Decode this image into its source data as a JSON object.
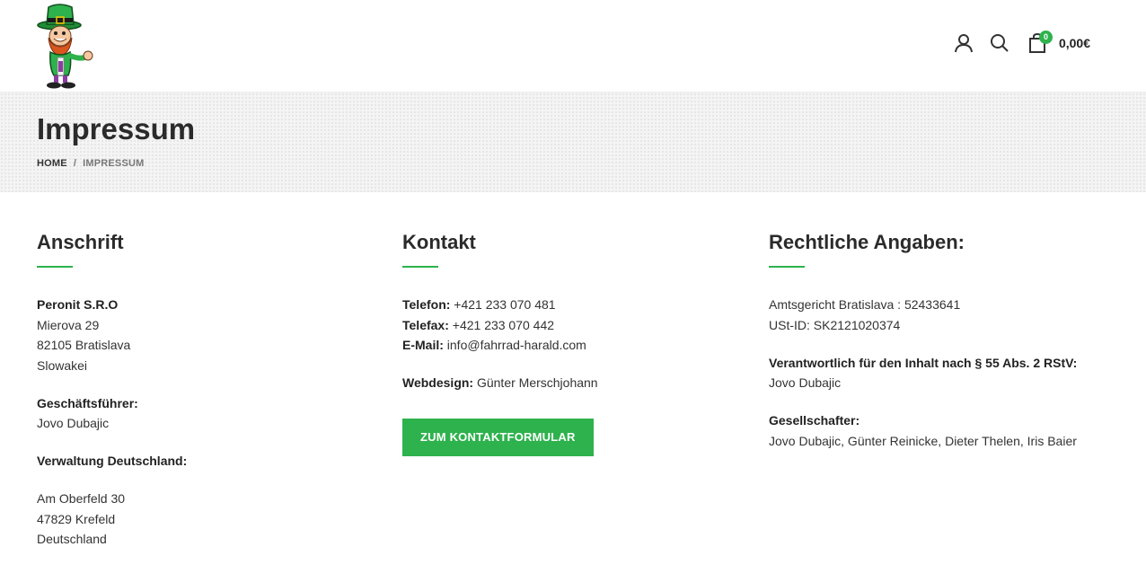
{
  "header": {
    "cart": {
      "count": "0",
      "total": "0,00€"
    }
  },
  "title_band": {
    "title": "Impressum",
    "breadcrumb": {
      "home": "HOME",
      "separator": "/",
      "current": "IMPRESSUM"
    }
  },
  "anschrift": {
    "heading": "Anschrift",
    "company": "Peronit S.R.O",
    "street": "Mierova 29",
    "city": "82105 Bratislava",
    "country": "Slowakei",
    "ceo_label": "Geschäftsführer:",
    "ceo_name": "Jovo Dubajic",
    "admin_label": "Verwaltung Deutschland:",
    "admin_street": "Am Oberfeld 30",
    "admin_city": "47829 Krefeld",
    "admin_country": "Deutschland"
  },
  "kontakt": {
    "heading": "Kontakt",
    "phone_label": "Telefon:",
    "phone": " +421 233 070 481",
    "fax_label": "Telefax:",
    "fax": " +421 233 070 442",
    "email_label": "E-Mail:",
    "email": " info@fahrrad-harald.com",
    "webdesign_label": "Webdesign:",
    "webdesign": " Günter Merschjohann",
    "button_label": "ZUM KONTAKTFORMULAR"
  },
  "rechtliches": {
    "heading": "Rechtliche Angaben:",
    "court": "Amtsgericht Bratislava : 52433641",
    "vat": "USt-ID: SK2121020374",
    "responsible_label": "Verantwortlich für den Inhalt nach § 55 Abs. 2 RStV:",
    "responsible_name": "Jovo Dubajic",
    "partners_label": "Gesellschafter:",
    "partners": "Jovo Dubajic, Günter Reinicke, Dieter Thelen, Iris Baier"
  },
  "colors": {
    "accent": "#2eb24d",
    "title": "#2b2b2b",
    "band": "#f4f4f4"
  },
  "icons": {
    "account": "user-icon",
    "search": "search-icon",
    "cart": "shopping-bag-icon"
  }
}
